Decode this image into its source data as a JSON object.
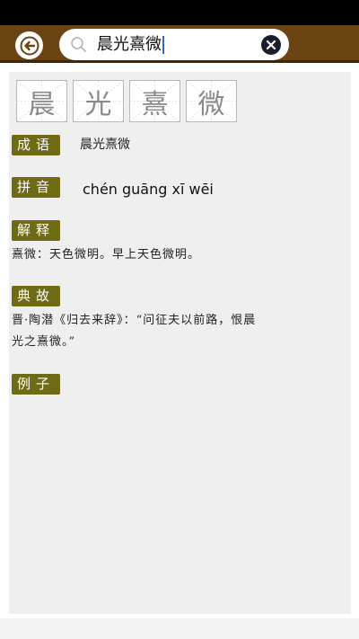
{
  "search": {
    "query": "晨光熹微"
  },
  "characters": [
    "晨",
    "光",
    "熹",
    "微"
  ],
  "sections": {
    "idiom": {
      "label": "成语",
      "value": "晨光熹微"
    },
    "pinyin": {
      "label": "拼音",
      "value": "chén guāng xī wēi"
    },
    "meaning": {
      "label": "解释",
      "value": "熹微：天色微明。早上天色微明。"
    },
    "source": {
      "label": "典故",
      "line1": "晋·陶潜《归去来辞》：“问征夫以前路，恨晨",
      "line2": "光之熹微。”"
    },
    "example": {
      "label": "例子"
    }
  },
  "colors": {
    "header_bg": "#6a4412",
    "tag_bg": "#6e6a16",
    "content_bg": "#efefef"
  },
  "icons": {
    "back": "arrow-left-circle-icon",
    "search": "magnifier-icon",
    "clear": "close-circle-icon"
  }
}
